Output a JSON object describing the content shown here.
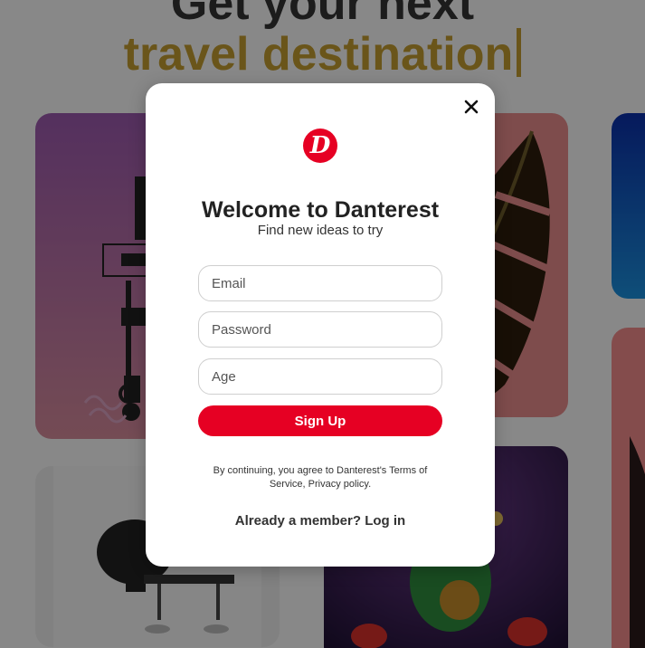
{
  "hero": {
    "line1": "Get your next",
    "line2": "travel destination"
  },
  "modal": {
    "logo_letter": "D",
    "title": "Welcome to Danterest",
    "subtitle": "Find new ideas to try",
    "email_placeholder": "Email",
    "password_placeholder": "Password",
    "age_placeholder": "Age",
    "signup_label": "Sign Up",
    "terms_prefix": "By continuing, you agree to Danterest's ",
    "terms_link": "Terms of Service",
    "terms_sep": ", ",
    "privacy_link": "Privacy policy",
    "terms_suffix": ".",
    "login_link": "Already a member? Log in"
  },
  "colors": {
    "accent": "#e60023",
    "hero_highlight": "#c29b30",
    "overlay": "rgba(0,0,0,0.45)"
  },
  "icons": {
    "close": "close-icon",
    "logo": "danterest-logo"
  }
}
